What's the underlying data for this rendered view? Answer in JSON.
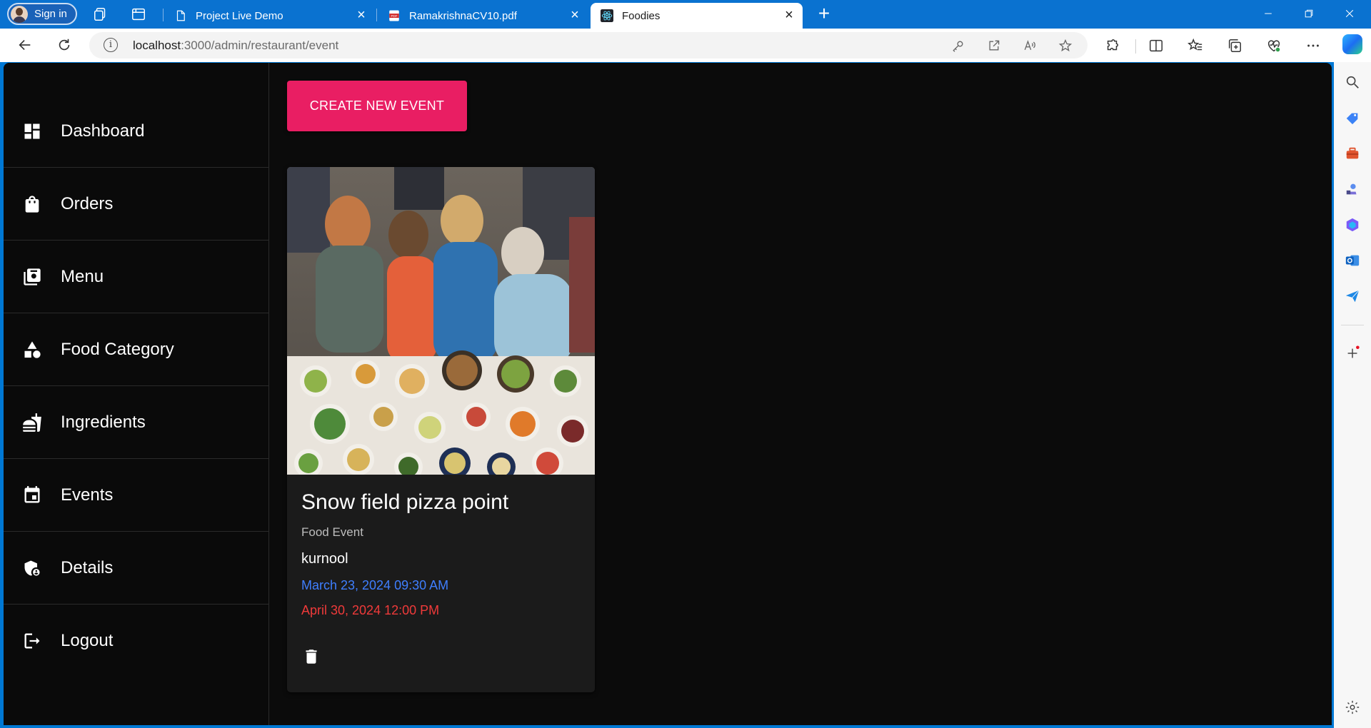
{
  "browser": {
    "profile_label": "Sign in",
    "tabs": [
      {
        "title": "Project Live Demo"
      },
      {
        "title": "RamakrishnaCV10.pdf"
      },
      {
        "title": "Foodies"
      }
    ],
    "url_host": "localhost",
    "url_path": ":3000/admin/restaurant/event"
  },
  "sidebar": {
    "items": [
      {
        "label": "Dashboard",
        "icon": "dashboard-icon"
      },
      {
        "label": "Orders",
        "icon": "shopping-bag-icon"
      },
      {
        "label": "Menu",
        "icon": "restaurant-menu-icon"
      },
      {
        "label": "Food Category",
        "icon": "category-icon"
      },
      {
        "label": "Ingredients",
        "icon": "fastfood-icon"
      },
      {
        "label": "Events",
        "icon": "event-icon"
      },
      {
        "label": "Details",
        "icon": "admin-panel-icon"
      },
      {
        "label": "Logout",
        "icon": "logout-icon"
      }
    ]
  },
  "main": {
    "create_button": "CREATE NEW EVENT",
    "events": [
      {
        "name": "Snow field pizza point",
        "type": "Food Event",
        "location": "kurnool",
        "start": "March 23, 2024 09:30 AM",
        "end": "April 30, 2024 12:00 PM"
      }
    ]
  },
  "colors": {
    "accent": "#e91e63",
    "start_date": "#3f7fff",
    "end_date": "#f03a3a",
    "background": "#0b0b0b",
    "card": "#1b1b1b"
  }
}
